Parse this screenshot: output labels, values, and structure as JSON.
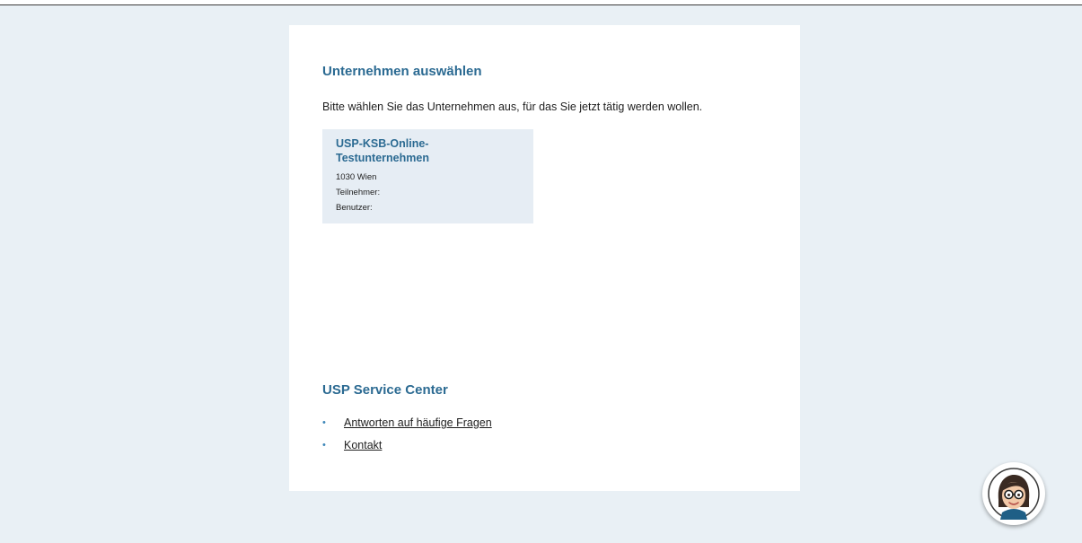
{
  "main": {
    "select_title": "Unternehmen auswählen",
    "intro_text": "Bitte wählen Sie das Unternehmen aus, für das Sie jetzt tätig werden wollen.",
    "companies": [
      {
        "name": "USP-KSB-Online-Testunternehmen",
        "city": "1030 Wien",
        "participants_label": "Teilnehmer:",
        "users_label": "Benutzer:"
      }
    ]
  },
  "service": {
    "title": "USP Service Center",
    "links": [
      {
        "label": "Antworten auf häufige Fragen"
      },
      {
        "label": "Kontakt"
      }
    ]
  },
  "assistant": {
    "icon": "assistant-avatar-icon"
  },
  "colors": {
    "page_background": "#e9f0f5",
    "card_background": "#ffffff",
    "heading": "#2b6a92",
    "tile_background": "#e6edf4",
    "bullet": "#3d86b8"
  }
}
